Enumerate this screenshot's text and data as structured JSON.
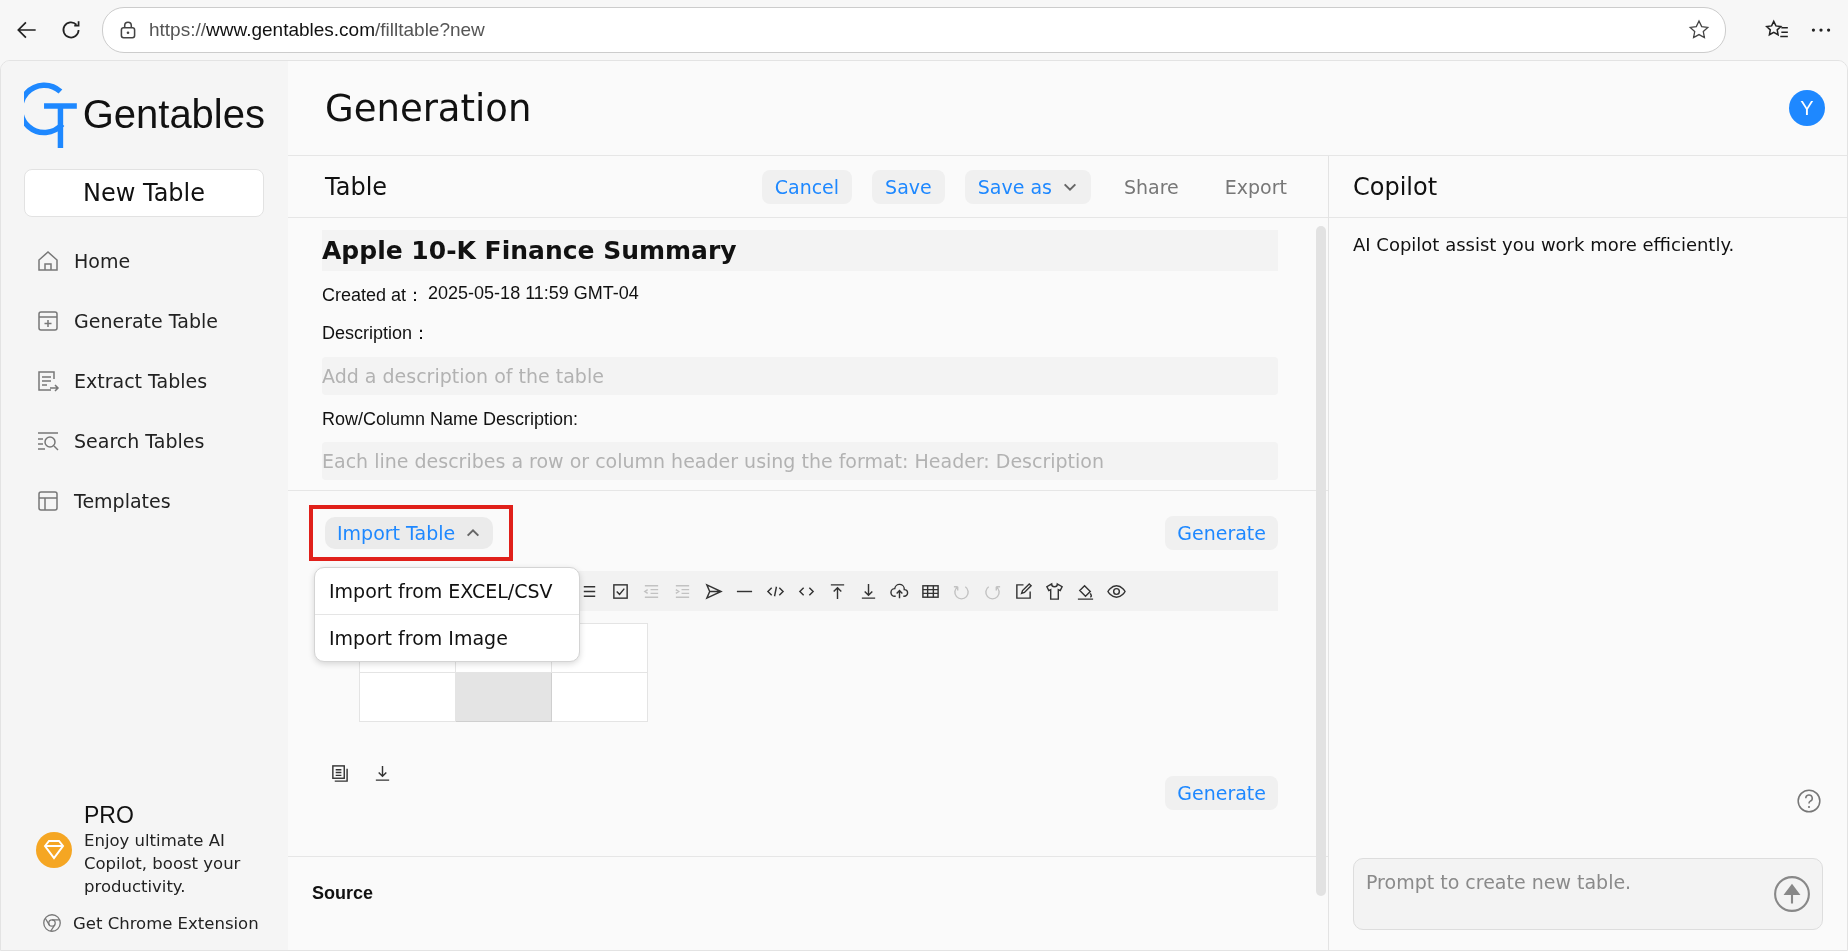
{
  "browser": {
    "url_scheme": "https://",
    "url_host": "www.gentables.com",
    "url_path": "/filltable?new"
  },
  "sidebar": {
    "logo_text": "Gentables",
    "new_button": "New Table",
    "items": [
      {
        "label": "Home",
        "kind": "home"
      },
      {
        "label": "Generate Table",
        "kind": "generate"
      },
      {
        "label": "Extract Tables",
        "kind": "extract"
      },
      {
        "label": "Search Tables",
        "kind": "search"
      },
      {
        "label": "Templates",
        "kind": "templates"
      }
    ],
    "pro": {
      "badge": "PRO",
      "text": "Enjoy ultimate AI Copilot, boost your productivity."
    },
    "extension": "Get Chrome Extension"
  },
  "header": {
    "title": "Generation",
    "avatar": "Y"
  },
  "table_panel": {
    "title": "Table",
    "actions": [
      {
        "label": "Cancel",
        "kind": "link"
      },
      {
        "label": "Save",
        "kind": "link"
      },
      {
        "label": "Save as",
        "kind": "dropdown"
      },
      {
        "label": "Share",
        "kind": "plain"
      },
      {
        "label": "Export",
        "kind": "plain"
      }
    ],
    "name": "Apple 10-K Finance Summary",
    "created_label": "Created at：",
    "created_value": "2025-05-18 11:59 GMT-04",
    "description_label": "Description：",
    "description_placeholder": "Add a description of the table",
    "rowcol_label": "Row/Column Name Description:",
    "rowcol_placeholder": "Each line describes a row or column header using the format: Header: Description"
  },
  "editor": {
    "import_button": {
      "label": "Import Table",
      "expanded": true,
      "highlighted": true
    },
    "import_menu": [
      "Import from EXCEL/CSV",
      "Import from Image"
    ],
    "generate": "Generate",
    "toolbar": [
      {
        "kind": "list",
        "disabled": false
      },
      {
        "kind": "checkbox",
        "disabled": false
      },
      {
        "kind": "outdent",
        "disabled": true
      },
      {
        "kind": "indent",
        "disabled": true
      },
      {
        "kind": "send",
        "disabled": false
      },
      {
        "kind": "rule",
        "disabled": false
      },
      {
        "kind": "code",
        "disabled": false
      },
      {
        "kind": "brackets",
        "disabled": false
      },
      {
        "kind": "align-top",
        "disabled": false
      },
      {
        "kind": "align-bottom",
        "disabled": false
      },
      {
        "kind": "upload",
        "disabled": false
      },
      {
        "kind": "table",
        "disabled": false
      },
      {
        "kind": "undo",
        "disabled": true
      },
      {
        "kind": "redo",
        "disabled": true
      },
      {
        "kind": "edit",
        "disabled": false
      },
      {
        "kind": "shirt",
        "disabled": false
      },
      {
        "kind": "fill",
        "disabled": false
      },
      {
        "kind": "eye",
        "disabled": false
      }
    ],
    "grid": [
      [
        {
          "selected": false
        },
        {
          "selected": false
        },
        {
          "selected": false
        }
      ],
      [
        {
          "selected": false
        },
        {
          "selected": true
        },
        {
          "selected": false
        }
      ]
    ],
    "bottom_generate": "Generate"
  },
  "source": {
    "title": "Source"
  },
  "copilot": {
    "title": "Copilot",
    "intro": "AI Copilot assist you work more efficiently.",
    "prompt_placeholder": "Prompt to create new table."
  }
}
